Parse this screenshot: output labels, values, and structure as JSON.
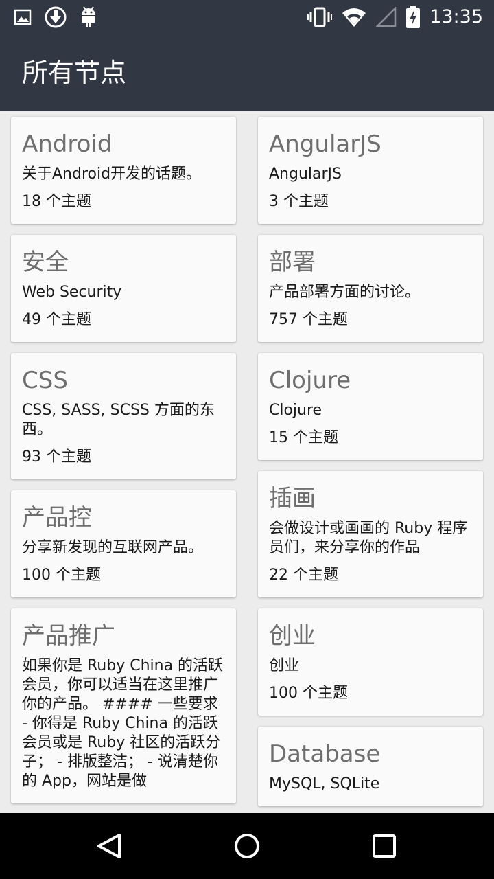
{
  "status_bar": {
    "time": "13:35",
    "left_icons": [
      "image-icon",
      "download-icon",
      "android-icon"
    ],
    "right_icons": [
      "vibrate-icon",
      "wifi-icon",
      "signal-icon",
      "battery-charging-icon"
    ]
  },
  "app_bar": {
    "title": "所有节点"
  },
  "nodes": [
    {
      "title": "Android",
      "desc": "关于Android开发的话题。",
      "count": "18 个主题"
    },
    {
      "title": "AngularJS",
      "desc": "AngularJS",
      "count": "3 个主题"
    },
    {
      "title": "安全",
      "desc": "Web Security",
      "count": "49 个主题"
    },
    {
      "title": "部署",
      "desc": "产品部署方面的讨论。",
      "count": "757 个主题"
    },
    {
      "title": "CSS",
      "desc": "CSS, SASS, SCSS 方面的东西。",
      "count": "93 个主题"
    },
    {
      "title": "Clojure",
      "desc": "Clojure",
      "count": "15 个主题"
    },
    {
      "title": "产品控",
      "desc": "分享新发现的互联网产品。",
      "count": "100 个主题"
    },
    {
      "title": "插画",
      "desc": "会做设计或画画的 Ruby 程序员们，来分享你的作品",
      "count": "22 个主题"
    },
    {
      "title": "产品推广",
      "desc": "如果你是 Ruby China 的活跃会员，你可以适当在这里推广你的产品。 #### 一些要求 - 你得是 Ruby China 的活跃会员或是 Ruby 社区的活跃分子； - 排版整洁； - 说清楚你的 App，网站是做",
      "count": ""
    },
    {
      "title": "创业",
      "desc": "创业",
      "count": "100 个主题"
    },
    {
      "title": "Database",
      "desc": "MySQL, SQLite",
      "count": ""
    }
  ],
  "nav_bar": {
    "icons": [
      "back-icon",
      "home-icon",
      "recents-icon"
    ]
  },
  "colors": {
    "app_bar": "#313843",
    "background": "#ececec",
    "card": "#fafafa",
    "title_text": "#6e6e6e"
  }
}
